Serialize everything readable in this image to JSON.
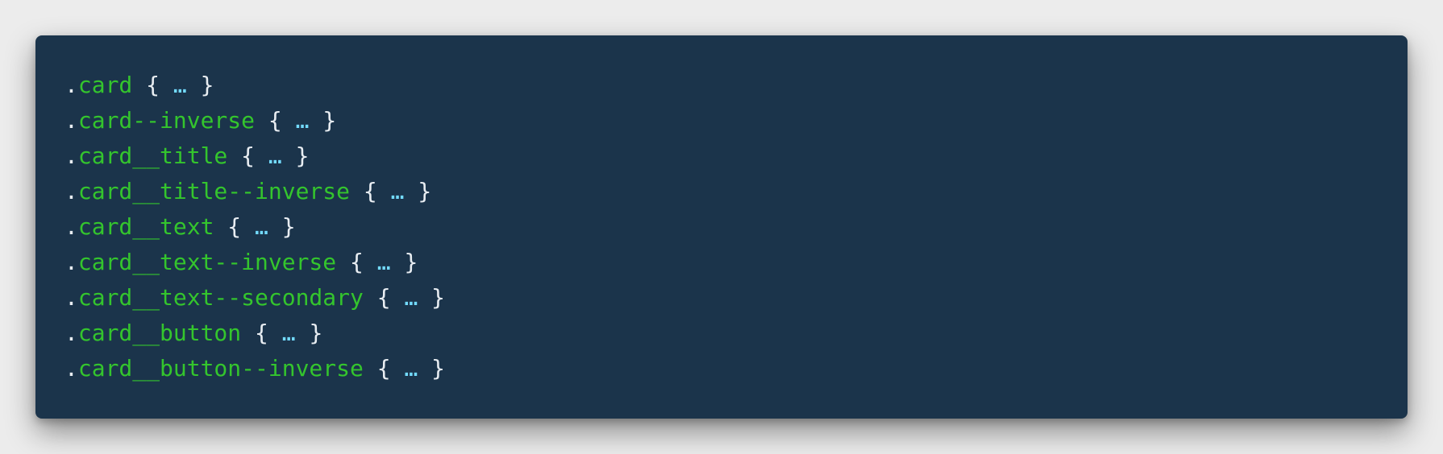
{
  "colors": {
    "page_background": "#ececec",
    "panel_background": "#1b344b",
    "selector": "#34c52d",
    "punctuation": "#e8edf2",
    "ellipsis": "#73dbff"
  },
  "code": {
    "dot": ".",
    "open_brace": "{",
    "ellipsis": "…",
    "close_brace": "}",
    "selectors": [
      "card",
      "card--inverse",
      "card__title",
      "card__title--inverse",
      "card__text",
      "card__text--inverse",
      "card__text--secondary",
      "card__button",
      "card__button--inverse"
    ]
  }
}
